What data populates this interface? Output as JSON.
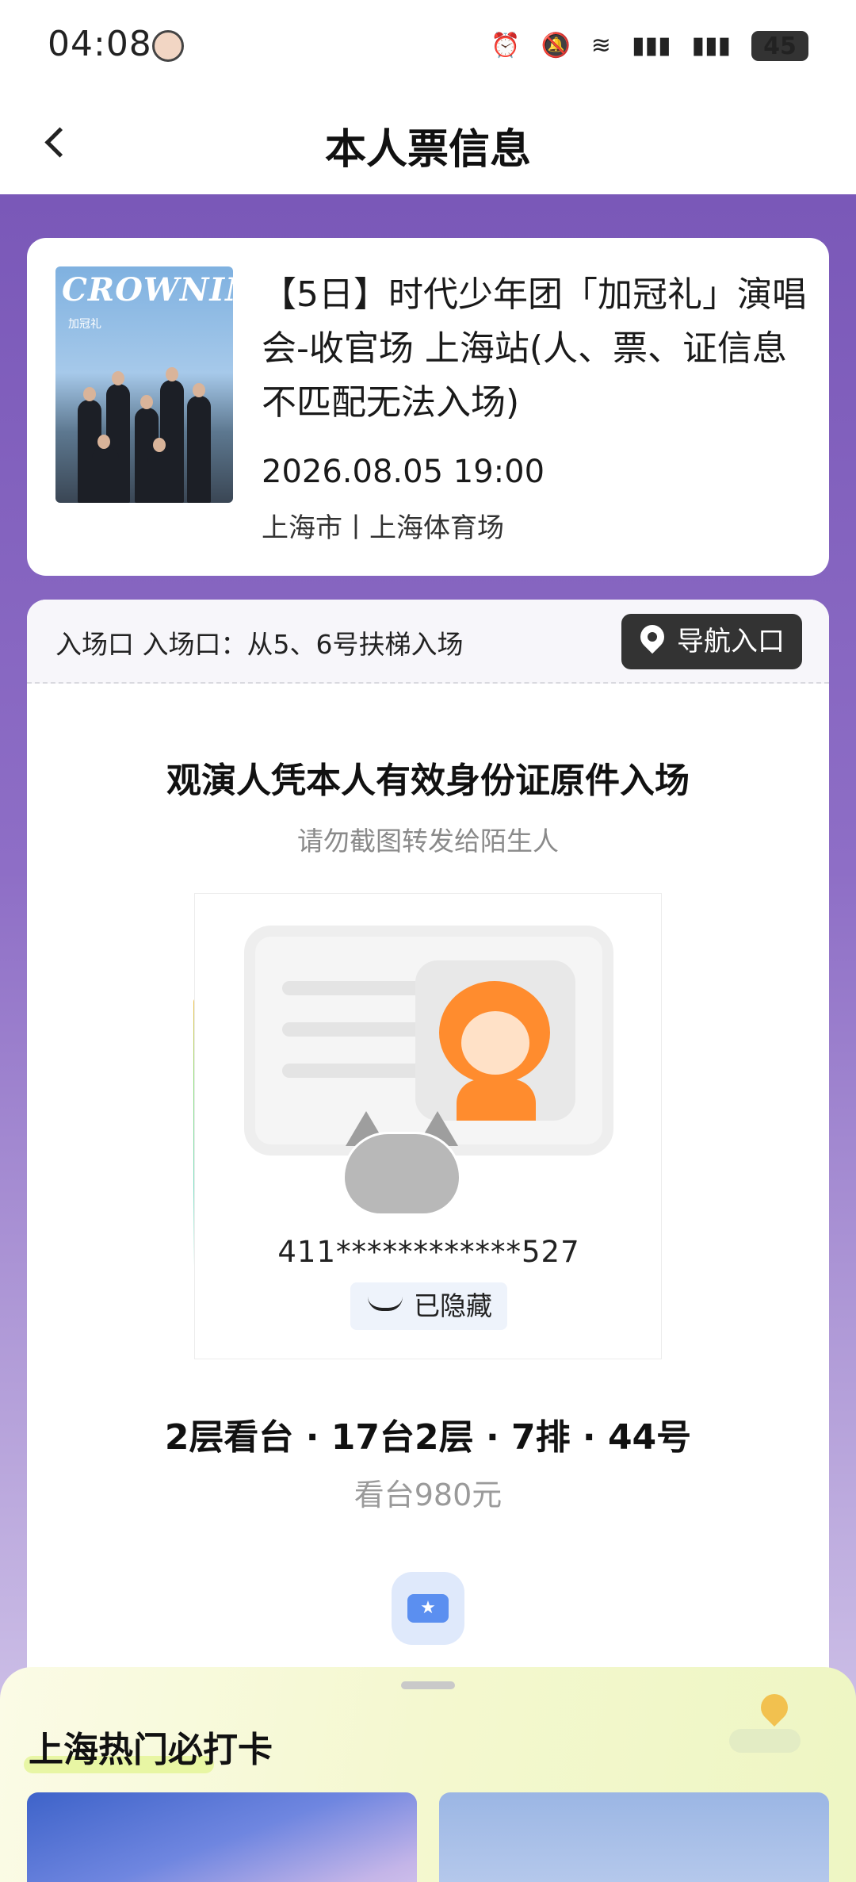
{
  "status_bar": {
    "time": "04:08",
    "icons": [
      "alarm-icon",
      "mute-icon",
      "wifi-icon",
      "signal-4g-icon",
      "signal-5a-icon"
    ],
    "battery": "45"
  },
  "nav": {
    "title": "本人票信息"
  },
  "concert": {
    "poster_title": "CROWNING",
    "poster_subtitle": "加冠礼",
    "title": "【5日】时代少年团「加冠礼」演唱会-收官场 上海站(人、票、证信息不匹配无法入场)",
    "datetime": "2026.08.05 19:00",
    "venue": "上海市丨上海体育场"
  },
  "ticket": {
    "entrance": "入场口 入场口：从5、6号扶梯入场",
    "nav_button": "导航入口",
    "id_notice": "观演人凭本人有效身份证原件入场",
    "id_warning": "请勿截图转发给陌生人",
    "id_number": "411************527",
    "hidden_label": "已隐藏",
    "seat": "2层看台 · 17台2层 · 7排 · 44号",
    "price": "看台980元"
  },
  "bottom_sheet": {
    "title": "上海热门必打卡"
  },
  "colors": {
    "purple_bg": "#7b5ab8",
    "nav_button_bg": "#333333",
    "accent_orange": "#ff8c2e"
  }
}
